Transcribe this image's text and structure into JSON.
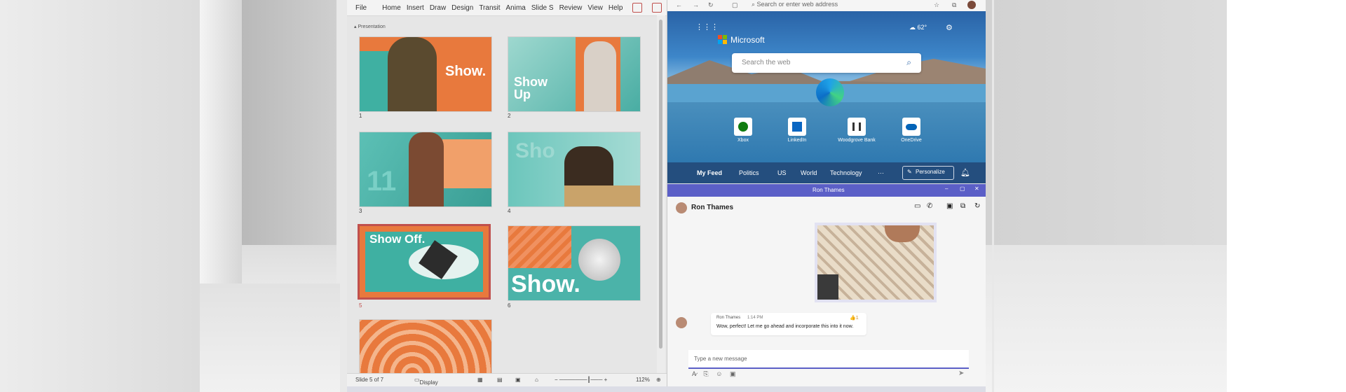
{
  "ppt": {
    "ribbon": [
      "File",
      "Home",
      "Insert",
      "Draw",
      "Design",
      "Transit",
      "Anima",
      "Slide S",
      "Review",
      "View",
      "Help"
    ],
    "section_label": "Presentation",
    "slides": [
      {
        "num": "1",
        "text": "Show."
      },
      {
        "num": "2",
        "text": "Show Up"
      },
      {
        "num": "3",
        "text": "11"
      },
      {
        "num": "4",
        "text": "Sho"
      },
      {
        "num": "5",
        "text": "Show Off."
      },
      {
        "num": "6",
        "text": "Show."
      }
    ],
    "status": {
      "slide": "Slide 5 of 7",
      "display": "Display Settings",
      "zoom": "112%"
    }
  },
  "edge": {
    "address_placeholder": "Search or enter web address",
    "brand": "Microsoft",
    "weather": "62°",
    "search_placeholder": "Search the web",
    "tiles": [
      "Xbox",
      "LinkedIn",
      "Woodgrove Bank",
      "OneDrive"
    ],
    "feed_tabs": [
      "My Feed",
      "Politics",
      "US",
      "World",
      "Technology",
      "···"
    ],
    "personalize": "Personalize"
  },
  "teams": {
    "window_title": "Ron Thames",
    "contact": "Ron Thames",
    "msg_sender": "Ron Thames",
    "msg_time": "1:14 PM",
    "msg_text": "Wow, perfect! Let me go ahead and incorporate this into it now.",
    "reaction": "👍1",
    "compose_placeholder": "Type a new message"
  },
  "colors": {
    "ppt_accent": "#c0504d",
    "teal": "#4bb3a9",
    "orange": "#e8793d",
    "teams_purple": "#5b5fc7",
    "edge_blue": "#244e7e"
  }
}
